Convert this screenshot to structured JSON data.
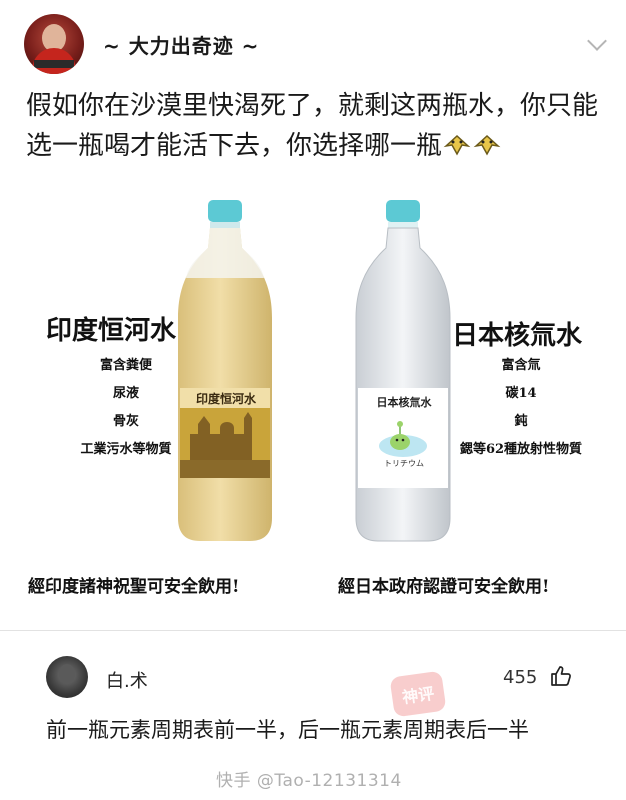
{
  "post": {
    "username": "~ 大力出奇迹 ~",
    "text": "假如你在沙漠里快渴死了，就剩这两瓶水，你只能选一瓶喝才能活下去，你选择哪一瓶",
    "emoji": "crossed-fingers-emoji"
  },
  "meme": {
    "left": {
      "title": "印度恒河水",
      "items": [
        "富含粪便",
        "尿液",
        "骨灰",
        "工業污水等物質"
      ],
      "label": "印度恒河水",
      "caption": "經印度諸神祝聖可安全飲用!",
      "liquid_color": "#e9d39a"
    },
    "right": {
      "title": "日本核氚水",
      "items": [
        "富含氚",
        "碳14",
        "鈍",
        "鍶等62種放射性物質"
      ],
      "label": "日本核氚水",
      "label_sub": "トリチウム",
      "caption": "經日本政府認證可安全飲用!",
      "liquid_color": "#e7eaee"
    }
  },
  "comment": {
    "author": "白.术",
    "likes": "455",
    "text": "前一瓶元素周期表前一半，后一瓶元素周期表后一半",
    "stamp": "神评"
  },
  "watermark": "快手 @Tao-12131314",
  "colors": {
    "cap": "#5cc9d4",
    "text": "#1a1a1a",
    "divider": "#e2e2e2"
  }
}
